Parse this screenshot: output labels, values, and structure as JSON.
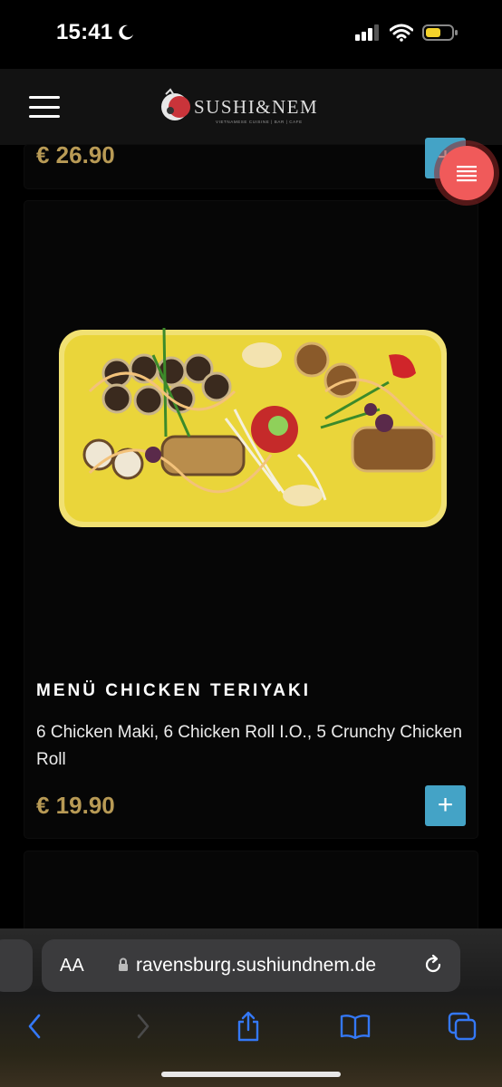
{
  "status_bar": {
    "time": "15:41"
  },
  "header": {
    "logo_text": "SUSHI&NEM",
    "logo_subtext": "VIETNAMESE CUISINE | BAR | CAFE"
  },
  "products": [
    {
      "price": "€ 26.90",
      "add_label": "+"
    },
    {
      "title": "MENÜ CHICKEN TERIYAKI",
      "description": "6 Chicken Maki, 6 Chicken Roll I.O., 5 Crunchy Chicken Roll",
      "price": "€ 19.90",
      "add_label": "+"
    }
  ],
  "browser": {
    "aa_label": "AA",
    "url": "ravensburg.sushiundnem.de"
  },
  "colors": {
    "price": "#b89a55",
    "add_button": "#44a3c6",
    "fab": "#f05a5a",
    "ios_blue": "#3478f6"
  }
}
